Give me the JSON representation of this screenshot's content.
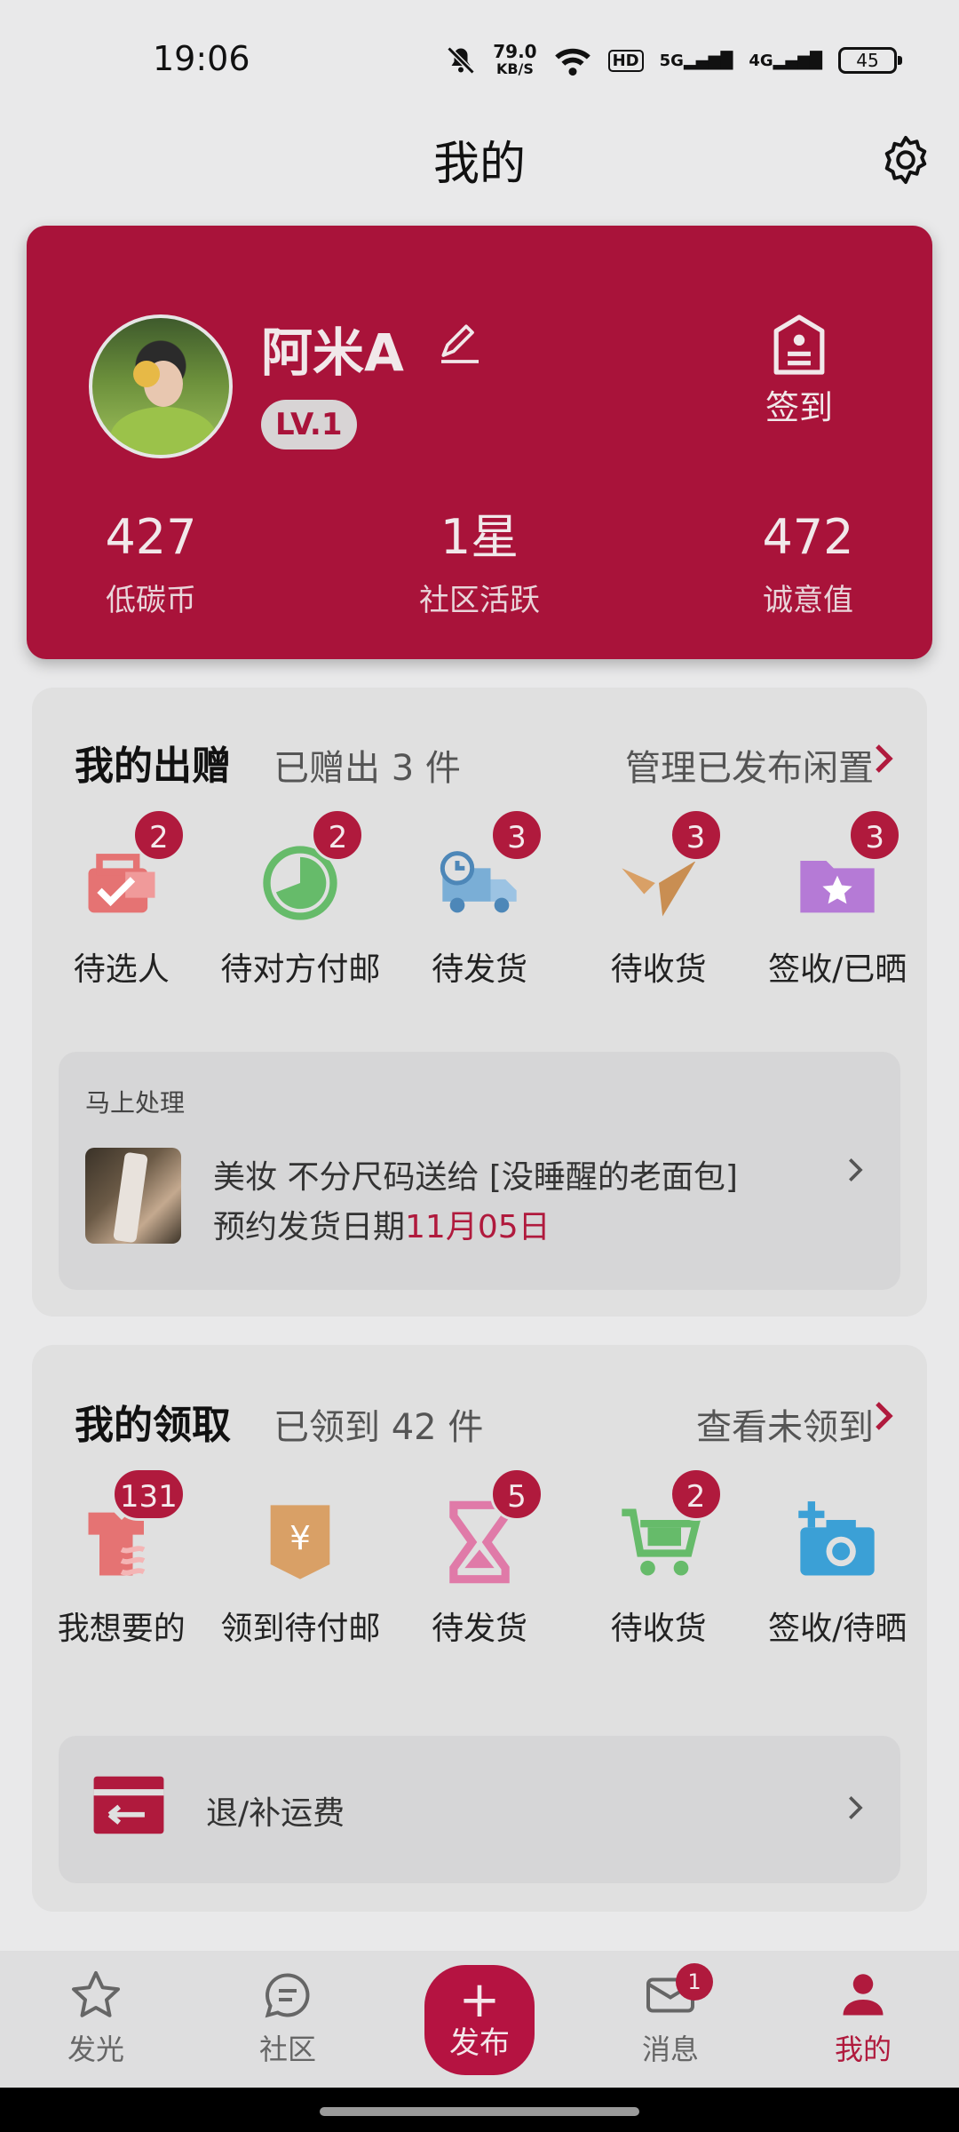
{
  "status_bar": {
    "time": "19:06",
    "net_speed": "79.0",
    "net_unit": "KB/S",
    "hd_label": "HD",
    "sim1": "5G",
    "sim2": "4G",
    "battery": "45",
    "icons": [
      "mute-icon",
      "wifi-icon",
      "signal-icon",
      "battery-icon"
    ]
  },
  "header": {
    "title": "我的",
    "settings_icon": "gear-icon"
  },
  "profile": {
    "username": "阿米A",
    "level": "LV.1",
    "checkin_label": "签到",
    "accent_color": "#a9133a",
    "stats": [
      {
        "value": "427",
        "label": "低碳币"
      },
      {
        "value": "1星",
        "label": "社区活跃"
      },
      {
        "value": "472",
        "label": "诚意值"
      }
    ]
  },
  "giving": {
    "title": "我的出赠",
    "subtitle": "已赠出 3 件",
    "link": "管理已发布闲置",
    "items": [
      {
        "label": "待选人",
        "badge": "2",
        "icon": "briefcase-check-icon",
        "color": "#e57373"
      },
      {
        "label": "待对方付邮",
        "badge": "2",
        "icon": "clock-icon",
        "color": "#66bb6a"
      },
      {
        "label": "待发货",
        "badge": "3",
        "icon": "truck-icon",
        "color": "#7aaed6"
      },
      {
        "label": "待收货",
        "badge": "3",
        "icon": "handshake-icon",
        "color": "#d9a066"
      },
      {
        "label": "签收/已晒",
        "badge": "3",
        "icon": "folder-star-icon",
        "color": "#b57ad6"
      }
    ],
    "todo": {
      "title": "马上处理",
      "line1": "美妆 不分尺码送给 [没睡醒的老面包]",
      "line2_prefix": "预约发货日期",
      "line2_date": "11月05日"
    }
  },
  "receiving": {
    "title": "我的领取",
    "subtitle": "已领到 42 件",
    "link": "查看未领到",
    "items": [
      {
        "label": "我想要的",
        "badge": "131",
        "icon": "shirt-icon",
        "color": "#e57373"
      },
      {
        "label": "领到待付邮",
        "badge": "",
        "icon": "yen-tag-icon",
        "color": "#d9a066"
      },
      {
        "label": "待发货",
        "badge": "5",
        "icon": "hourglass-icon",
        "color": "#e07aa8"
      },
      {
        "label": "待收货",
        "badge": "2",
        "icon": "cart-icon",
        "color": "#66bb6a"
      },
      {
        "label": "签收/待晒",
        "badge": "",
        "icon": "camera-plus-icon",
        "color": "#3ba0d6"
      }
    ],
    "refund_label": "退/补运费"
  },
  "bottom_nav": {
    "items": [
      {
        "label": "发光",
        "icon": "star-icon"
      },
      {
        "label": "社区",
        "icon": "chat-icon"
      },
      {
        "label": "发布",
        "icon": "plus-icon"
      },
      {
        "label": "消息",
        "icon": "mail-icon",
        "badge": "1"
      },
      {
        "label": "我的",
        "icon": "person-icon",
        "active": true
      }
    ]
  }
}
